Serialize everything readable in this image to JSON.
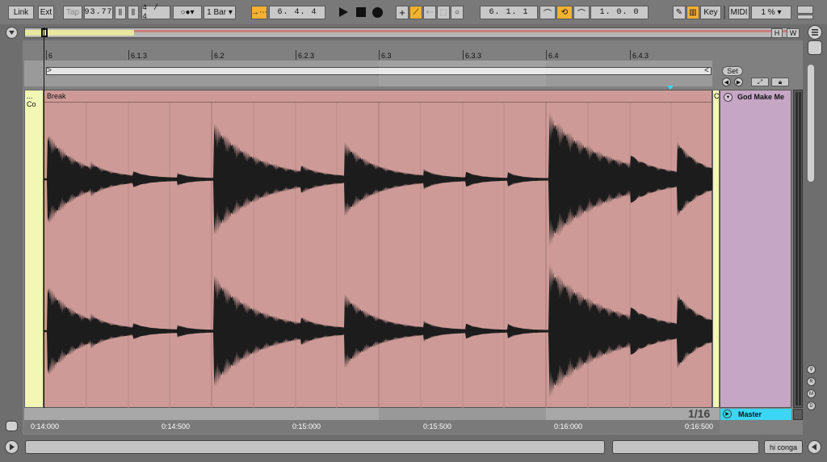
{
  "transport": {
    "link_label": "Link",
    "ext_label": "Ext",
    "tap_label": "Tap",
    "tempo": "93.77",
    "time_signature": "4 / 4",
    "quantize": "1 Bar",
    "position": "6.   4.   4",
    "loop_start": "6.   1.   1",
    "loop_length": "1.   0.   0"
  },
  "right_controls": {
    "key_label": "Key",
    "midi_label": "MIDI",
    "zoom": "1 %"
  },
  "overview": {
    "h_label": "H",
    "w_label": "W"
  },
  "ruler": {
    "labels": [
      "6",
      "6.1.3",
      "6.2",
      "6.2.3",
      "6.3",
      "6.3.3",
      "6.4",
      "6.4.3"
    ]
  },
  "clip": {
    "left_name": "... Co",
    "name": "Break",
    "right_name": "C",
    "color": "#cd9a97"
  },
  "side_panel": {
    "set_label": "Set",
    "track_name": "God Make Me",
    "master_label": "Master",
    "grid_label": "1/16"
  },
  "time_axis": {
    "labels": [
      "0:14:000",
      "0:14:500",
      "0:15:000",
      "0:15:500",
      "0:16:000",
      "0:16:500"
    ]
  },
  "status": {
    "device_label": "hi conga"
  },
  "colors": {
    "accent_orange": "#f5b132",
    "master_cyan": "#3bd6f5",
    "clip_pink": "#cd9a97",
    "yellow_lane": "#f2f7b4",
    "track_lilac": "#c5a6c4"
  }
}
